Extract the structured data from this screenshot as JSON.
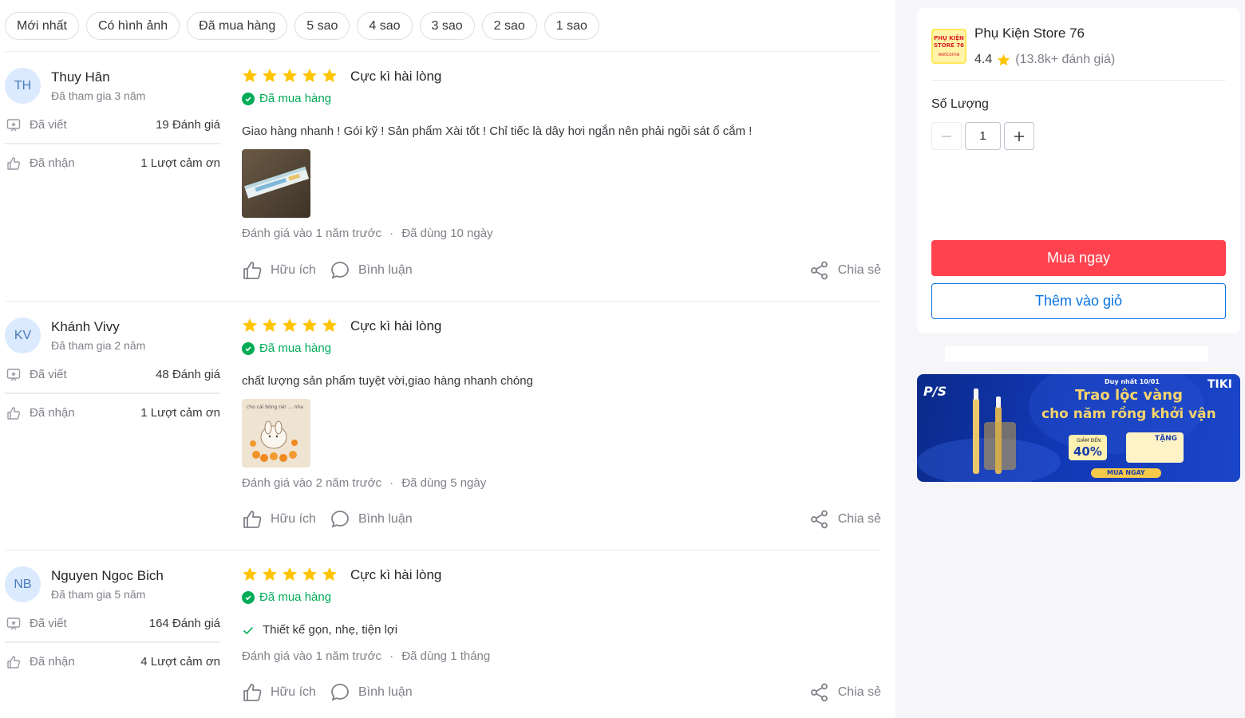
{
  "filters": [
    "Mới nhất",
    "Có hình ảnh",
    "Đã mua hàng",
    "5 sao",
    "4 sao",
    "3 sao",
    "2 sao",
    "1 sao"
  ],
  "reviews": [
    {
      "initials": "TH",
      "name": "Thuy Hân",
      "joined": "Đã tham gia 3 năm",
      "written_label": "Đã viết",
      "written_value": "19 Đánh giá",
      "received_label": "Đã nhận",
      "received_value": "1 Lượt cảm ơn",
      "rating": 5,
      "title": "Cực kì hài lòng",
      "bought": "Đã mua hàng",
      "text": "Giao hàng nhanh ! Gói kỹ ! Sản phẩm Xài tốt ! Chỉ tiếc là dây hơi ngắn nên phải ngồi sát ổ cắm !",
      "time": "Đánh giá vào 1 năm trước",
      "used": "Đã dùng 10 ngày",
      "helpful": "Hữu ích",
      "comment": "Bình luận",
      "share": "Chia sẻ"
    },
    {
      "initials": "KV",
      "name": "Khánh Vivy",
      "joined": "Đã tham gia 2 năm",
      "written_label": "Đã viết",
      "written_value": "48 Đánh giá",
      "received_label": "Đã nhận",
      "received_value": "1 Lượt cảm ơn",
      "rating": 5,
      "title": "Cực kì hài lòng",
      "bought": "Đã mua hàng",
      "text": "chất lượng sản phẩm tuyệt vời,giao hàng nhanh chóng",
      "image_caption": "cho cái bông nè! ... nha",
      "time": "Đánh giá vào 2 năm trước",
      "used": "Đã dùng 5 ngày",
      "helpful": "Hữu ích",
      "comment": "Bình luận",
      "share": "Chia sẻ"
    },
    {
      "initials": "NB",
      "name": "Nguyen Ngoc Bich",
      "joined": "Đã tham gia 5 năm",
      "written_label": "Đã viết",
      "written_value": "164 Đánh giá",
      "received_label": "Đã nhận",
      "received_value": "4 Lượt cảm ơn",
      "rating": 5,
      "title": "Cực kì hài lòng",
      "bought": "Đã mua hàng",
      "feature": "Thiết kế gọn, nhẹ, tiện lợi",
      "time": "Đánh giá vào 1 năm trước",
      "used": "Đã dùng 1 tháng",
      "helpful": "Hữu ích",
      "comment": "Bình luận",
      "share": "Chia sẻ"
    }
  ],
  "seller": {
    "logo_text": [
      "PHỤ KIỆN",
      "STORE 76",
      "welcome"
    ],
    "name": "Phụ Kiện Store 76",
    "rating": "4.4",
    "rating_count": "(13.8k+ đánh giá)",
    "quantity_label": "Số Lượng",
    "quantity": "1",
    "buy_now": "Mua ngay",
    "add_to_cart": "Thêm vào giỏ"
  },
  "banner": {
    "brand": "P/S",
    "date": "Duy nhất 10/01",
    "line1": "Trao lộc vàng",
    "line2": "cho năm rồng khởi vận",
    "discount_label": "GIẢM ĐẾN",
    "discount": "40%",
    "gift": "TẶNG",
    "cta": "MUA NGAY",
    "tiki": "TIKI"
  },
  "colors": {
    "accent_green": "#00ab56",
    "star": "#ffc400",
    "buy_red": "#ff424e",
    "link_blue": "#0b74e5"
  }
}
